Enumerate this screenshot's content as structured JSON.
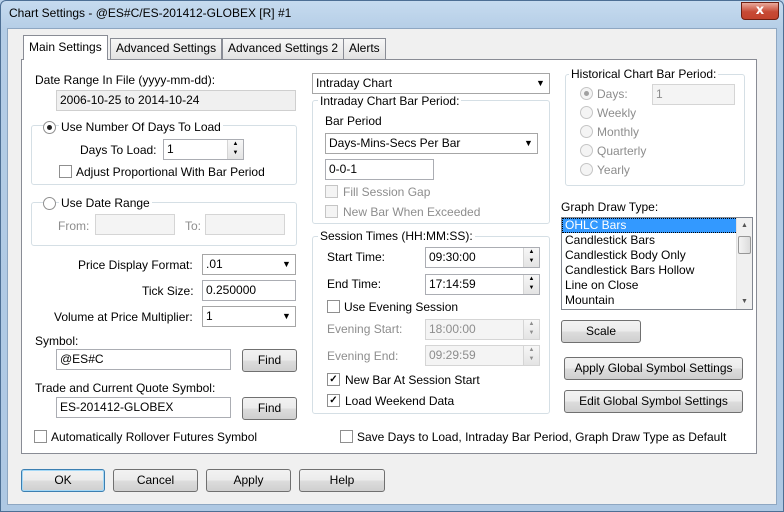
{
  "window": {
    "title": "Chart Settings - @ES#C/ES-201412-GLOBEX [R]  #1",
    "close_glyph": "x"
  },
  "tabs": [
    "Main Settings",
    "Advanced Settings",
    "Advanced Settings 2",
    "Alerts"
  ],
  "date_range": {
    "label": "Date Range In File (yyyy-mm-dd):",
    "value": "2006-10-25 to 2014-10-24",
    "use_days_label": "Use Number Of Days To Load",
    "days_to_load_label": "Days To Load:",
    "days_to_load_value": "1",
    "adjust_label": "Adjust Proportional With Bar Period",
    "use_date_range_label": "Use Date Range",
    "from_label": "From:",
    "to_label": "To:"
  },
  "price": {
    "format_label": "Price Display Format:",
    "format_value": ".01",
    "tick_label": "Tick Size:",
    "tick_value": "0.250000",
    "vap_label": "Volume at Price Multiplier:",
    "vap_value": "1"
  },
  "symbol": {
    "label": "Symbol:",
    "value": "@ES#C",
    "find_label": "Find",
    "trade_label": "Trade and Current Quote Symbol:",
    "trade_value": "ES-201412-GLOBEX",
    "trade_find_label": "Find"
  },
  "rollover_label": "Automatically Rollover Futures Symbol",
  "chart_type_value": "Intraday Chart",
  "intraday": {
    "group_title": "Intraday Chart Bar Period:",
    "bar_period_label": "Bar Period",
    "bar_period_value": "Days-Mins-Secs Per Bar",
    "period_value": "0-0-1",
    "fill_gap_label": "Fill Session Gap",
    "new_bar_exceeded_label": "New Bar When Exceeded"
  },
  "session": {
    "group_title": "Session Times (HH:MM:SS):",
    "start_label": "Start Time:",
    "start_value": "09:30:00",
    "end_label": "End Time:",
    "end_value": "17:14:59",
    "use_evening_label": "Use Evening Session",
    "evening_start_label": "Evening Start:",
    "evening_start_value": "18:00:00",
    "evening_end_label": "Evening End:",
    "evening_end_value": "09:29:59",
    "new_bar_session_label": "New Bar At Session Start",
    "load_weekend_label": "Load Weekend Data"
  },
  "historical": {
    "group_title": "Historical Chart Bar Period:",
    "options": [
      "Days:",
      "Weekly",
      "Monthly",
      "Quarterly",
      "Yearly"
    ],
    "days_value": "1"
  },
  "graph_draw": {
    "label": "Graph Draw Type:",
    "items": [
      "OHLC Bars",
      "Candlestick Bars",
      "Candlestick Body Only",
      "Candlestick Bars Hollow",
      "Line on Close",
      "Mountain"
    ],
    "selected": "OHLC Bars"
  },
  "buttons": {
    "scale": "Scale",
    "apply_global": "Apply Global Symbol Settings",
    "edit_global": "Edit Global Symbol Settings",
    "ok": "OK",
    "cancel": "Cancel",
    "apply": "Apply",
    "help": "Help"
  },
  "save_default_label": "Save Days to Load, Intraday Bar Period, Graph Draw Type as Default",
  "check_mark": "✓",
  "arrows": {
    "down": "▼",
    "up": "▲"
  }
}
